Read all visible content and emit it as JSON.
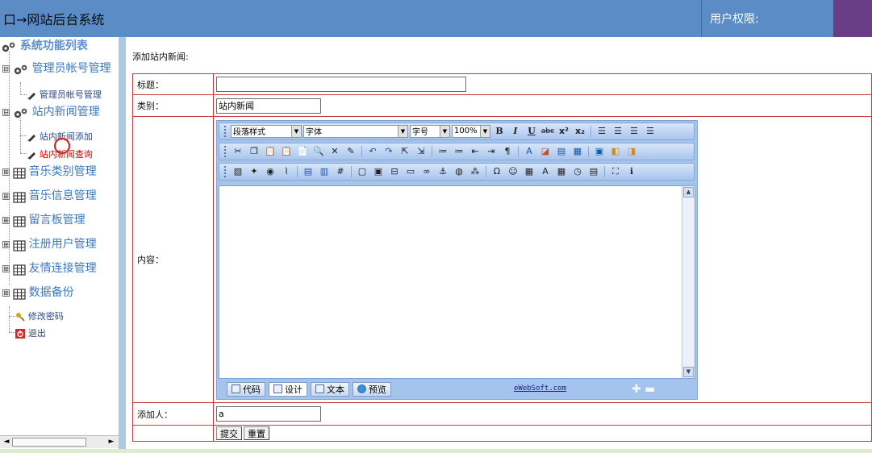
{
  "header": {
    "title": "口→网站后台系统",
    "permissions_label": "用户权限:",
    "colors": {
      "bar": "#5b8cc6",
      "accent_block": "#6b3d86"
    }
  },
  "sidebar": {
    "root_label": "系统功能列表",
    "groups": [
      {
        "label": "管理员帐号管理",
        "icon": "gears-icon",
        "expander": "⊟",
        "children": [
          "管理员帐号管理"
        ]
      },
      {
        "label": "站内新闻管理",
        "icon": "gears-icon",
        "expander": "⊟",
        "children": [
          "站内新闻添加",
          "站内新闻查询"
        ]
      },
      {
        "label": "音乐类别管理",
        "icon": "grid-icon",
        "expander": "⊞"
      },
      {
        "label": "音乐信息管理",
        "icon": "grid-icon",
        "expander": "⊞"
      },
      {
        "label": "留言板管理",
        "icon": "grid-icon",
        "expander": "⊞"
      },
      {
        "label": "注册用户管理",
        "icon": "grid-icon",
        "expander": "⊞"
      },
      {
        "label": "友情连接管理",
        "icon": "grid-icon",
        "expander": "⊞"
      },
      {
        "label": "数据备份",
        "icon": "grid-icon",
        "expander": "⊞"
      }
    ],
    "links": [
      {
        "label": "修改密码",
        "icon": "key-icon"
      },
      {
        "label": "退出",
        "icon": "power-icon"
      }
    ],
    "scroll_left": "◄",
    "scroll_right": "►"
  },
  "form": {
    "heading": "添加站内新闻:",
    "title_label": "标题：",
    "title_value": "",
    "category_label": "类别：",
    "category_value": "站内新闻",
    "content_label": "内容：",
    "author_label": "添加人：",
    "author_value": "a",
    "submit_label": "提交",
    "reset_label": "重置"
  },
  "editor": {
    "paragraph_style": "段落样式",
    "font": "字体",
    "font_size": "字号",
    "zoom": "100%",
    "bold": "B",
    "italic": "I",
    "underline": "U",
    "strike": "abc",
    "superscript": "x²",
    "subscript": "x₂",
    "mode_code": "代码",
    "mode_design": "设计",
    "mode_text": "文本",
    "mode_preview": "预览",
    "brand": "eWebSoft.com",
    "zoom_controls": "✚ ▬"
  }
}
